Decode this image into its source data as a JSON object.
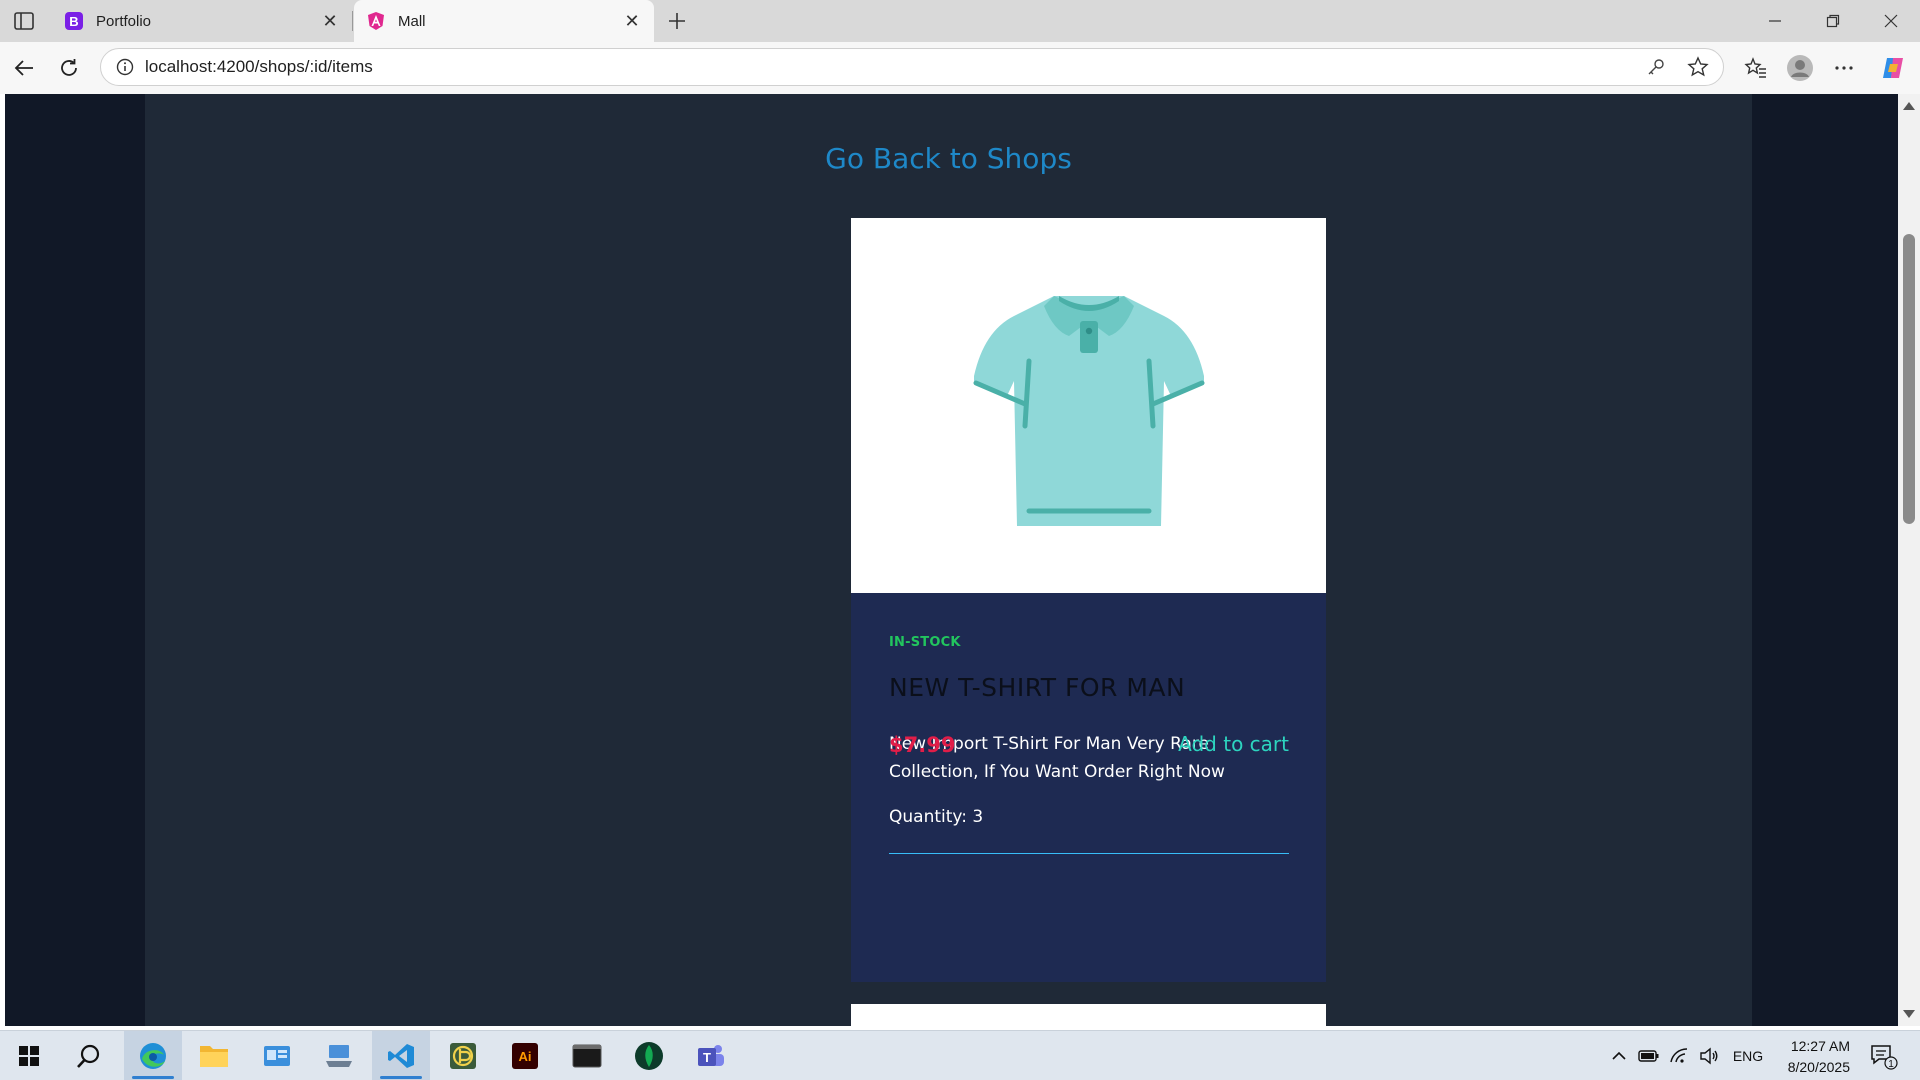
{
  "browser": {
    "tabs": [
      {
        "title": "Portfolio",
        "favicon": "bootstrap-icon",
        "active": false
      },
      {
        "title": "Mall",
        "favicon": "angular-icon",
        "active": true
      }
    ],
    "address_url": "localhost:4200/shops/:id/items"
  },
  "page": {
    "go_back_link": "Go Back to Shops",
    "item": {
      "image_icon": "polo-tshirt-icon",
      "stock_status": "IN-STOCK",
      "title": "NEW T-SHIRT FOR MAN",
      "description": "New Import T-Shirt For Man Very Rare Collection, If You Want Order Right Now",
      "quantity": "Quantity: 3",
      "price": "$7.99",
      "add_to_cart": "Add to cart"
    }
  },
  "taskbar": {
    "apps": [
      "start-icon",
      "search-icon",
      "edge-icon",
      "file-explorer-icon",
      "control-panel-icon",
      "network-icon",
      "vscode-icon",
      "app-icon",
      "illustrator-icon",
      "terminal-icon",
      "mongodb-icon",
      "teams-icon"
    ],
    "illustrator_label": "Ai",
    "tray_language": "ENG",
    "time": "12:27 AM",
    "date": "8/20/2025",
    "notification_count": "1"
  },
  "colors": {
    "page_bg": "#111827",
    "content_bg": "#1f2937",
    "card_body_bg": "#1e2a52",
    "link": "#1e88c8",
    "stock": "#22c55e",
    "price": "#e11d48",
    "add_to_cart": "#2dd4bf",
    "shirt": "#8fd8d8",
    "shirt_dark": "#4ab0a8"
  }
}
